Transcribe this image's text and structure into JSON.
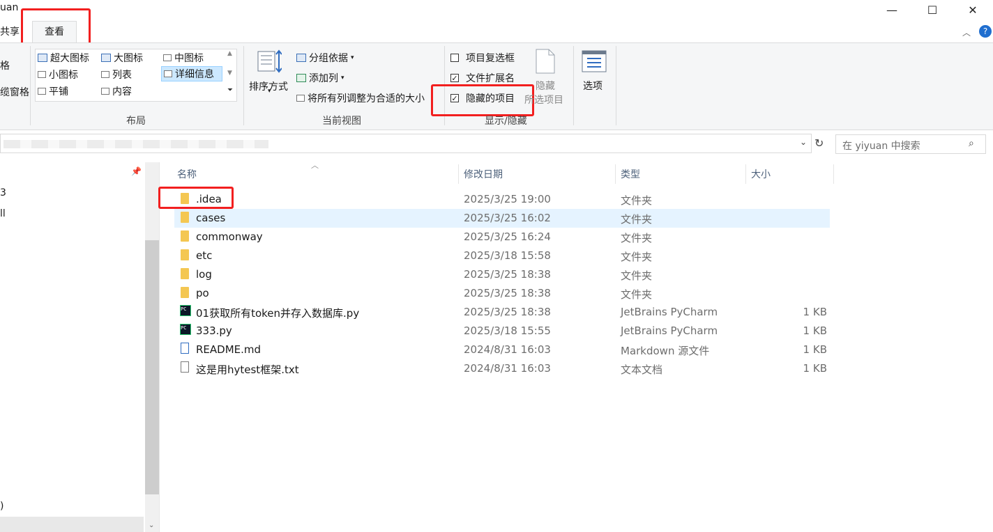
{
  "window": {
    "title_partial": "uan",
    "minimize": "—",
    "maximize": "☐",
    "close": "✕"
  },
  "tabs": {
    "share": "共享",
    "view": "查看"
  },
  "ribbon": {
    "left_partial": [
      "格",
      "缆窗格"
    ],
    "layout": {
      "items": [
        "超大图标",
        "大图标",
        "中图标",
        "小图标",
        "列表",
        "详细信息",
        "平铺",
        "内容"
      ],
      "group_label": "布局"
    },
    "current_view": {
      "sort": "排序方式",
      "group_by": "分组依据",
      "add_columns": "添加列",
      "fit_columns": "将所有列调整为合适的大小",
      "group_label": "当前视图"
    },
    "show_hide": {
      "item_checkboxes": "项目复选框",
      "item_checkboxes_checked": false,
      "file_extensions": "文件扩展名",
      "file_extensions_checked": true,
      "hidden_items": "隐藏的项目",
      "hidden_items_checked": true,
      "hide_selected_line1": "隐藏",
      "hide_selected_line2": "所选项目",
      "group_label": "显示/隐藏"
    },
    "options": {
      "label": "选项"
    }
  },
  "search": {
    "placeholder": "在 yiyuan 中搜索"
  },
  "nav": {
    "partial_items": [
      "3",
      "ll",
      ")"
    ]
  },
  "columns": {
    "name": "名称",
    "date": "修改日期",
    "type": "类型",
    "size": "大小"
  },
  "files": [
    {
      "name": ".idea",
      "date": "2025/3/25 19:00",
      "type": "文件夹",
      "size": "",
      "icon": "folder"
    },
    {
      "name": "cases",
      "date": "2025/3/25 16:02",
      "type": "文件夹",
      "size": "",
      "icon": "folder"
    },
    {
      "name": "commonway",
      "date": "2025/3/25 16:24",
      "type": "文件夹",
      "size": "",
      "icon": "folder"
    },
    {
      "name": "etc",
      "date": "2025/3/18 15:58",
      "type": "文件夹",
      "size": "",
      "icon": "folder"
    },
    {
      "name": "log",
      "date": "2025/3/25 18:38",
      "type": "文件夹",
      "size": "",
      "icon": "folder"
    },
    {
      "name": "po",
      "date": "2025/3/25 18:38",
      "type": "文件夹",
      "size": "",
      "icon": "folder"
    },
    {
      "name": "01获取所有token并存入数据库.py",
      "date": "2025/3/25 18:38",
      "type": "JetBrains PyCharm",
      "size": "1 KB",
      "icon": "pycharm"
    },
    {
      "name": "333.py",
      "date": "2025/3/18 15:55",
      "type": "JetBrains PyCharm",
      "size": "1 KB",
      "icon": "pycharm"
    },
    {
      "name": "README.md",
      "date": "2024/8/31 16:03",
      "type": "Markdown 源文件",
      "size": "1 KB",
      "icon": "markdown"
    },
    {
      "name": "这是用hytest框架.txt",
      "date": "2024/8/31 16:03",
      "type": "文本文档",
      "size": "1 KB",
      "icon": "text"
    }
  ],
  "colors": {
    "selection": "#e5f3ff",
    "highlight_box": "#f21f1f",
    "header_text": "#4c607a"
  }
}
